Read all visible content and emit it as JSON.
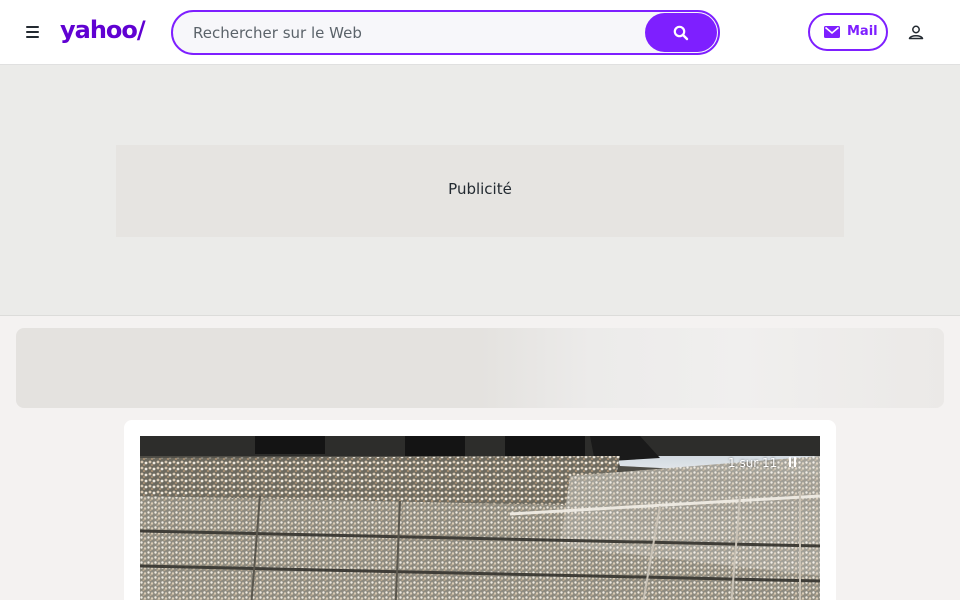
{
  "header": {
    "logo_text": "yahoo/",
    "search": {
      "placeholder": "Rechercher sur le Web",
      "value": ""
    },
    "search_button_icon": "search-icon",
    "mail_label": "Mail",
    "mail_icon": "envelope-icon",
    "profile_icon": "user-icon",
    "menu_icon": "hamburger-icon"
  },
  "ad": {
    "label": "Publicité"
  },
  "gallery": {
    "counter": "1 sur 11",
    "pause_icon": "pause-icon"
  },
  "colors": {
    "brand": "#6001d2",
    "accent": "#7e1fff",
    "header_bg": "#ffffff",
    "page_bg": "#f4f2f1"
  }
}
